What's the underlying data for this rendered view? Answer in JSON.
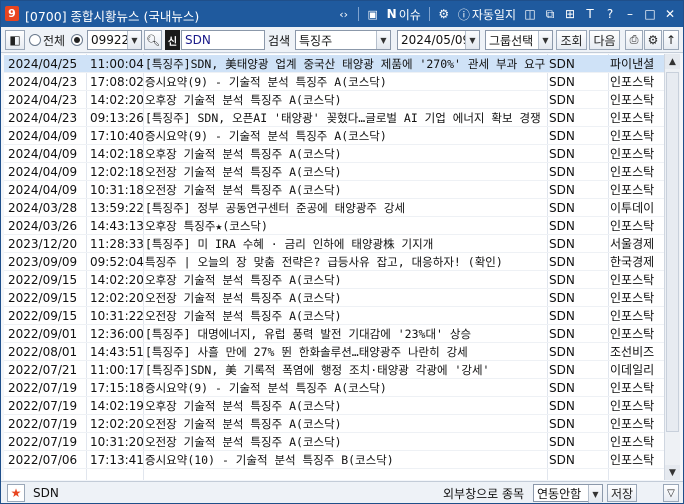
{
  "window": {
    "badge": "9",
    "title": "[0700] 종합시황뉴스 (국내뉴스)",
    "buttons": {
      "issue_n": "N",
      "issue": "이슈",
      "auto_log": "자동일지",
      "font": "T",
      "help": "?",
      "minimize": "–",
      "maximize": "□",
      "close": "✕"
    }
  },
  "toolbar": {
    "radio_all": "전체",
    "radio_code": "",
    "code_value": "099220",
    "stock_name": "SDN",
    "search_label": "검색",
    "search_value": "특징주",
    "date_value": "2024/05/09",
    "group_select": "그룹선택",
    "query_button": "조회",
    "next_button": "다음"
  },
  "news_rows": [
    {
      "date": "2024/04/25",
      "time": "11:00:04",
      "title": "[특징주]SDN, 美태양광 업계 중국산 태양광 제품에 '270%' 관세 부과 요구",
      "code": "SDN",
      "source": "파이낸셜"
    },
    {
      "date": "2024/04/23",
      "time": "17:08:02",
      "title": "증시요약(9) - 기술적 분석 특징주 A(코스닥)",
      "code": "SDN",
      "source": "인포스탁"
    },
    {
      "date": "2024/04/23",
      "time": "14:02:20",
      "title": "오후장 기술적 분석 특징주 A(코스닥)",
      "code": "SDN",
      "source": "인포스탁"
    },
    {
      "date": "2024/04/23",
      "time": "09:13:26",
      "title": "[특징주] SDN, 오픈AI '태양광' 꽂혔다…글로벌 AI 기업 에너지 확보 경쟁",
      "code": "SDN",
      "source": "인포스탁"
    },
    {
      "date": "2024/04/09",
      "time": "17:10:40",
      "title": "증시요약(9) - 기술적 분석 특징주 A(코스닥)",
      "code": "SDN",
      "source": "인포스탁"
    },
    {
      "date": "2024/04/09",
      "time": "14:02:18",
      "title": "오후장 기술적 분석 특징주 A(코스닥)",
      "code": "SDN",
      "source": "인포스탁"
    },
    {
      "date": "2024/04/09",
      "time": "12:02:18",
      "title": "오전장 기술적 분석 특징주 A(코스닥)",
      "code": "SDN",
      "source": "인포스탁"
    },
    {
      "date": "2024/04/09",
      "time": "10:31:18",
      "title": "오전장 기술적 분석 특징주 A(코스닥)",
      "code": "SDN",
      "source": "인포스탁"
    },
    {
      "date": "2024/03/28",
      "time": "13:59:22",
      "title": "[특징주] 정부 공동연구센터 준공에 태양광주 강세",
      "code": "SDN",
      "source": "이투데이"
    },
    {
      "date": "2024/03/26",
      "time": "14:43:13",
      "title": "오후장 특징주★(코스닥)",
      "code": "SDN",
      "source": "인포스탁"
    },
    {
      "date": "2023/12/20",
      "time": "11:28:33",
      "title": "[특징주] 미 IRA 수혜 · 금리 인하에 태양광株 기지개",
      "code": "SDN",
      "source": "서울경제"
    },
    {
      "date": "2023/09/09",
      "time": "09:52:04",
      "title": "특징주 | 오늘의 장 맞춤 전략은? 급등사유 잡고, 대응하자! (확인)",
      "code": "SDN",
      "source": "한국경제"
    },
    {
      "date": "2022/09/15",
      "time": "14:02:20",
      "title": "오후장 기술적 분석 특징주 A(코스닥)",
      "code": "SDN",
      "source": "인포스탁"
    },
    {
      "date": "2022/09/15",
      "time": "12:02:20",
      "title": "오전장 기술적 분석 특징주 A(코스닥)",
      "code": "SDN",
      "source": "인포스탁"
    },
    {
      "date": "2022/09/15",
      "time": "10:31:22",
      "title": "오전장 기술적 분석 특징주 A(코스닥)",
      "code": "SDN",
      "source": "인포스탁"
    },
    {
      "date": "2022/09/01",
      "time": "12:36:00",
      "title": "[특징주] 대명에너지, 유럽 풍력 발전 기대감에 '23%대' 상승",
      "code": "SDN",
      "source": "인포스탁"
    },
    {
      "date": "2022/08/01",
      "time": "14:43:51",
      "title": "[특징주] 사흘 만에 27% 뛴 한화솔루션…태양광주 나란히 강세",
      "code": "SDN",
      "source": "조선비즈"
    },
    {
      "date": "2022/07/21",
      "time": "11:00:17",
      "title": "[특징주]SDN, 美 기록적 폭염에 행정 조치·태양광 각광에 '강세'",
      "code": "SDN",
      "source": "이데일리"
    },
    {
      "date": "2022/07/19",
      "time": "17:15:18",
      "title": "증시요약(9) - 기술적 분석 특징주 A(코스닥)",
      "code": "SDN",
      "source": "인포스탁"
    },
    {
      "date": "2022/07/19",
      "time": "14:02:19",
      "title": "오후장 기술적 분석 특징주 A(코스닥)",
      "code": "SDN",
      "source": "인포스탁"
    },
    {
      "date": "2022/07/19",
      "time": "12:02:20",
      "title": "오전장 기술적 분석 특징주 A(코스닥)",
      "code": "SDN",
      "source": "인포스탁"
    },
    {
      "date": "2022/07/19",
      "time": "10:31:20",
      "title": "오전장 기술적 분석 특징주 A(코스닥)",
      "code": "SDN",
      "source": "인포스탁"
    },
    {
      "date": "2022/07/06",
      "time": "17:13:41",
      "title": "증시요약(10) - 기술적 분석 특징주 B(코스닥)",
      "code": "SDN",
      "source": "인포스탁"
    }
  ],
  "statusbar": {
    "stock_name": "SDN",
    "external_label": "외부창으로 종목",
    "link_select": "연동안함",
    "save_button": "저장"
  },
  "colors": {
    "titlebar": "#1f5a9e",
    "selected_row": "#cfe2f7",
    "badge": "#e8451f"
  }
}
